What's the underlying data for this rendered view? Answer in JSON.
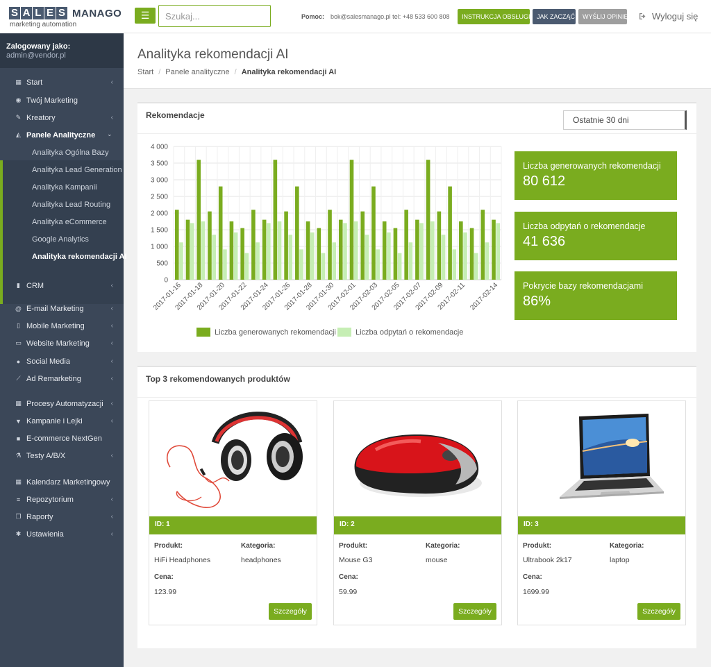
{
  "header": {
    "logo_letters": [
      "S",
      "A",
      "L",
      "E",
      "S"
    ],
    "logo_word": "MANAGO",
    "logo_sub": "marketing automation",
    "search_placeholder": "Szukaj...",
    "help_label": "Pomoc:",
    "help_contact": "bok@salesmanago.pl tel: +48 533 600 808",
    "btn_manual": "INSTRUKCJA OBSŁUGI",
    "btn_start": "JAK ZACZĄĆ",
    "btn_feedback": "WYŚLIJ OPINIĘ",
    "logout": "Wyloguj się"
  },
  "sidebar": {
    "logged_label": "Zalogowany jako:",
    "logged_user": "admin@vendor.pl",
    "items_top": [
      {
        "label": "Start",
        "icon": "th-icon",
        "chev": true
      },
      {
        "label": "Twój Marketing",
        "icon": "eye-icon",
        "chev": false
      },
      {
        "label": "Kreatory",
        "icon": "pencil-icon",
        "chev": true
      }
    ],
    "panele": {
      "label": "Panele Analityczne",
      "icon": "area-chart-icon",
      "subs": [
        "Analityka Ogólna Bazy",
        "Analityka Lead Generation",
        "Analityka Kampanii",
        "Analityka Lead Routing",
        "Analityka eCommerce",
        "Google Analytics",
        "Analityka rekomendacji AI"
      ]
    },
    "items_bottom": [
      {
        "label": "CRM",
        "icon": "bar-chart-icon",
        "chev": true
      },
      {
        "label": "E-mail Marketing",
        "icon": "at-icon",
        "chev": true
      },
      {
        "label": "Mobile Marketing",
        "icon": "mobile-icon",
        "chev": true
      },
      {
        "label": "Website Marketing",
        "icon": "laptop-icon",
        "chev": true
      },
      {
        "label": "Social Media",
        "icon": "users-icon",
        "chev": true
      },
      {
        "label": "Ad Remarketing",
        "icon": "line-chart-icon",
        "chev": true
      },
      {
        "label": "Procesy Automatyzacji",
        "icon": "th-icon",
        "chev": true
      },
      {
        "label": "Kampanie i Lejki",
        "icon": "filter-icon",
        "chev": true
      },
      {
        "label": "E-commerce NextGen",
        "icon": "lock-icon",
        "chev": false
      },
      {
        "label": "Testy A/B/X",
        "icon": "flask-icon",
        "chev": true
      },
      {
        "label": "Kalendarz Marketingowy",
        "icon": "calendar-icon",
        "chev": false
      },
      {
        "label": "Repozytorium",
        "icon": "database-icon",
        "chev": true
      },
      {
        "label": "Raporty",
        "icon": "copy-icon",
        "chev": true
      },
      {
        "label": "Ustawienia",
        "icon": "cogs-icon",
        "chev": true
      }
    ]
  },
  "page": {
    "title": "Analityka rekomendacji AI",
    "breadcrumb": [
      "Start",
      "Panele analityczne",
      "Analityka rekomendacji AI"
    ]
  },
  "recommendations": {
    "panel_title": "Rekomendacje",
    "range_select": "Ostatnie 30 dni",
    "stats": [
      {
        "label": "Liczba generowanych rekomendacji",
        "value": "80 612"
      },
      {
        "label": "Liczba odpytań o rekomendacje",
        "value": "41 636"
      },
      {
        "label": "Pokrycie bazy rekomendacjami",
        "value": "86%"
      }
    ]
  },
  "chart_data": {
    "type": "bar",
    "categories": [
      "2017-01-16",
      "2017-01-17",
      "2017-01-18",
      "2017-01-19",
      "2017-01-20",
      "2017-01-21",
      "2017-01-22",
      "2017-01-23",
      "2017-01-24",
      "2017-01-25",
      "2017-01-26",
      "2017-01-27",
      "2017-01-28",
      "2017-01-29",
      "2017-01-30",
      "2017-01-31",
      "2017-02-01",
      "2017-02-02",
      "2017-02-03",
      "2017-02-04",
      "2017-02-05",
      "2017-02-06",
      "2017-02-07",
      "2017-02-08",
      "2017-02-09",
      "2017-02-10",
      "2017-02-11",
      "2017-02-12",
      "2017-02-13",
      "2017-02-14"
    ],
    "tick_labels": [
      "2017-01-16",
      "2017-01-18",
      "2017-01-20",
      "2017-01-22",
      "2017-01-24",
      "2017-01-26",
      "2017-01-28",
      "2017-01-30",
      "2017-02-01",
      "2017-02-03",
      "2017-02-05",
      "2017-02-07",
      "2017-02-09",
      "2017-02-11",
      "2017-02-14"
    ],
    "series": [
      {
        "name": "Liczba generowanych rekomendacji",
        "color": "#7aac1f",
        "values": [
          2100,
          1800,
          3600,
          2050,
          2800,
          1750,
          1550,
          2100,
          1800,
          3600,
          2050,
          2800,
          1750,
          1550,
          2100,
          1800,
          3600,
          2050,
          2800,
          1750,
          1550,
          2100,
          1800,
          3600,
          2050,
          2800,
          1750,
          1550,
          2100,
          1800
        ]
      },
      {
        "name": "Liczba odpytań o rekomendacje",
        "color": "#c6eeb4",
        "values": [
          1120,
          1700,
          1750,
          1350,
          910,
          1420,
          800,
          1120,
          1700,
          1750,
          1350,
          910,
          1420,
          800,
          1120,
          1700,
          1750,
          1350,
          910,
          1420,
          800,
          1120,
          1700,
          1750,
          1350,
          910,
          1420,
          800,
          1120,
          1700
        ]
      }
    ],
    "y_ticks": [
      "0",
      "500",
      "1 000",
      "1 500",
      "2 000",
      "2 500",
      "3 000",
      "3 500",
      "4 000"
    ],
    "ylim": [
      0,
      4000
    ],
    "grid": true,
    "legend": "bottom"
  },
  "products": {
    "panel_title": "Top 3 rekomendowanych produktów",
    "labels": {
      "product": "Produkt:",
      "category": "Kategoria:",
      "price": "Cena:",
      "button": "Szczegóły"
    },
    "items": [
      {
        "id": "ID: 1",
        "name": "HiFi Headphones",
        "category": "headphones",
        "price": "123.99",
        "image": "headphones"
      },
      {
        "id": "ID: 2",
        "name": "Mouse G3",
        "category": "mouse",
        "price": "59.99",
        "image": "mouse"
      },
      {
        "id": "ID: 3",
        "name": "Ultrabook 2k17",
        "category": "laptop",
        "price": "1699.99",
        "image": "laptop"
      }
    ]
  }
}
